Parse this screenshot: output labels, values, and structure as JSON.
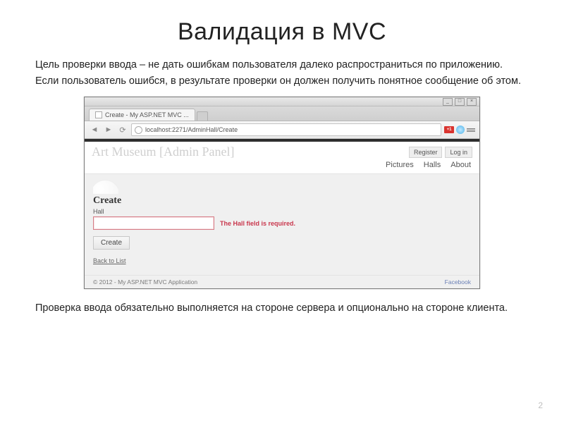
{
  "slide": {
    "title": "Валидация в MVC",
    "intro_line1": "Цель проверки ввода – не дать ошибкам пользователя далеко распространиться по приложению.",
    "intro_line2": "Если пользователь ошибся, в результате проверки он должен получить понятное сообщение об этом.",
    "outro": "Проверка ввода обязательно выполняется на стороне сервера и опционально на стороне клиента.",
    "page_number": "2"
  },
  "browser": {
    "win_min": "_",
    "win_max": "□",
    "win_close": "×",
    "tab_title": "Create - My ASP.NET MVC ...",
    "url": "localhost:2271/AdminHall/Create",
    "ext_badge": "+1"
  },
  "site": {
    "brand": "Art Museum [Admin Panel]",
    "auth": {
      "register": "Register",
      "login": "Log in"
    },
    "nav": {
      "pictures": "Pictures",
      "halls": "Halls",
      "about": "About"
    },
    "form": {
      "heading": "Create",
      "field_label": "Hall",
      "error": "The Hall field is required.",
      "submit": "Create",
      "back": "Back to List"
    },
    "footer": {
      "copyright": "© 2012 - My ASP.NET MVC Application",
      "facebook": "Facebook"
    }
  }
}
